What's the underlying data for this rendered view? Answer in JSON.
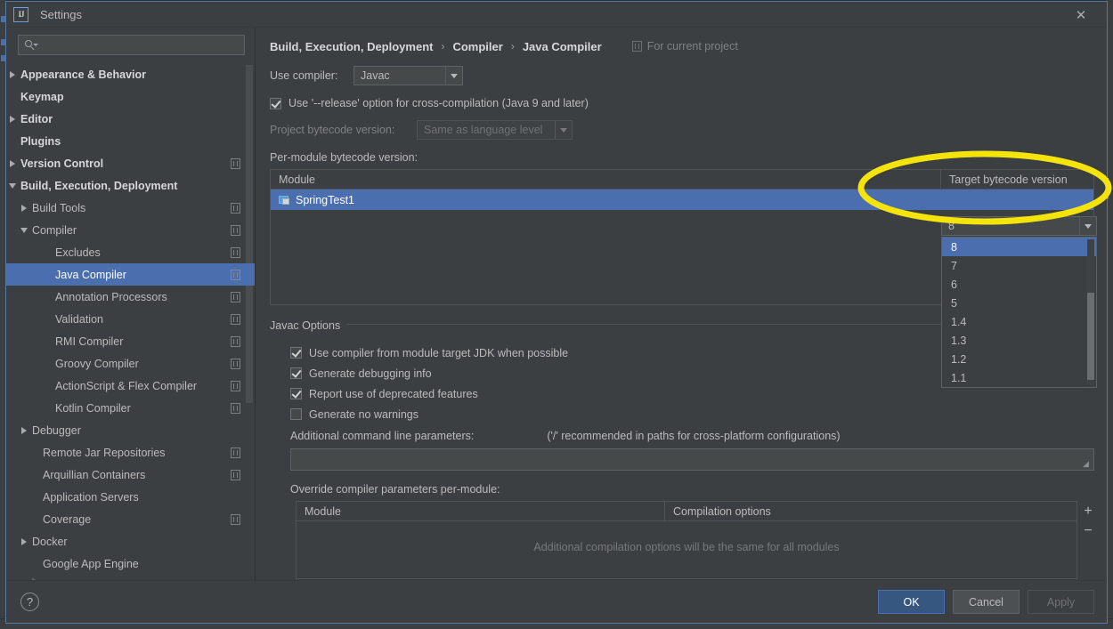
{
  "window": {
    "title": "Settings",
    "logo_text": "IJ",
    "close_label": "✕"
  },
  "sidebar": {
    "search": {
      "value": "",
      "placeholder": ""
    },
    "items": [
      {
        "label": "Appearance & Behavior",
        "twisty": "right",
        "bold": true,
        "indent": 10,
        "badge": false,
        "selected": false
      },
      {
        "label": "Keymap",
        "twisty": "none",
        "bold": true,
        "indent": 10,
        "badge": false,
        "selected": false
      },
      {
        "label": "Editor",
        "twisty": "right",
        "bold": true,
        "indent": 10,
        "badge": false,
        "selected": false
      },
      {
        "label": "Plugins",
        "twisty": "none",
        "bold": true,
        "indent": 10,
        "badge": false,
        "selected": false
      },
      {
        "label": "Version Control",
        "twisty": "right",
        "bold": true,
        "indent": 10,
        "badge": true,
        "selected": false
      },
      {
        "label": "Build, Execution, Deployment",
        "twisty": "down",
        "bold": true,
        "indent": 10,
        "badge": false,
        "selected": false
      },
      {
        "label": "Build Tools",
        "twisty": "right",
        "bold": false,
        "indent": 26,
        "badge": true,
        "selected": false
      },
      {
        "label": "Compiler",
        "twisty": "down",
        "bold": false,
        "indent": 26,
        "badge": true,
        "selected": false
      },
      {
        "label": "Excludes",
        "twisty": "none",
        "bold": false,
        "indent": 52,
        "badge": true,
        "selected": false
      },
      {
        "label": "Java Compiler",
        "twisty": "none",
        "bold": false,
        "indent": 52,
        "badge": true,
        "selected": true
      },
      {
        "label": "Annotation Processors",
        "twisty": "none",
        "bold": false,
        "indent": 52,
        "badge": true,
        "selected": false
      },
      {
        "label": "Validation",
        "twisty": "none",
        "bold": false,
        "indent": 52,
        "badge": true,
        "selected": false
      },
      {
        "label": "RMI Compiler",
        "twisty": "none",
        "bold": false,
        "indent": 52,
        "badge": true,
        "selected": false
      },
      {
        "label": "Groovy Compiler",
        "twisty": "none",
        "bold": false,
        "indent": 52,
        "badge": true,
        "selected": false
      },
      {
        "label": "ActionScript & Flex Compiler",
        "twisty": "none",
        "bold": false,
        "indent": 52,
        "badge": true,
        "selected": false
      },
      {
        "label": "Kotlin Compiler",
        "twisty": "none",
        "bold": false,
        "indent": 52,
        "badge": true,
        "selected": false
      },
      {
        "label": "Debugger",
        "twisty": "right",
        "bold": false,
        "indent": 26,
        "badge": false,
        "selected": false
      },
      {
        "label": "Remote Jar Repositories",
        "twisty": "none",
        "bold": false,
        "indent": 38,
        "badge": true,
        "selected": false
      },
      {
        "label": "Arquillian Containers",
        "twisty": "none",
        "bold": false,
        "indent": 38,
        "badge": true,
        "selected": false
      },
      {
        "label": "Application Servers",
        "twisty": "none",
        "bold": false,
        "indent": 38,
        "badge": false,
        "selected": false
      },
      {
        "label": "Coverage",
        "twisty": "none",
        "bold": false,
        "indent": 38,
        "badge": true,
        "selected": false
      },
      {
        "label": "Docker",
        "twisty": "right",
        "bold": false,
        "indent": 26,
        "badge": false,
        "selected": false
      },
      {
        "label": "Google App Engine",
        "twisty": "none",
        "bold": false,
        "indent": 38,
        "badge": false,
        "selected": false
      }
    ]
  },
  "main": {
    "breadcrumb": {
      "parts": [
        "Build, Execution, Deployment",
        "Compiler",
        "Java Compiler"
      ],
      "separator": "›"
    },
    "for_current_project": "For current project",
    "use_compiler": {
      "label": "Use compiler:",
      "value": "Javac"
    },
    "release_option": {
      "label": "Use '--release' option for cross-compilation (Java 9 and later)",
      "checked": true
    },
    "project_bytecode": {
      "label": "Project bytecode version:",
      "value": "Same as language level",
      "disabled": true
    },
    "per_module": {
      "label": "Per-module bytecode version:",
      "columns": [
        "Module",
        "Target bytecode version"
      ],
      "rows": [
        {
          "module": "SpringTest1",
          "target": "8",
          "selected": true
        }
      ],
      "add_button": "+",
      "remove_button": "−"
    },
    "bytecode_dropdown": {
      "open": true,
      "selected": "8",
      "options": [
        "8",
        "7",
        "6",
        "5",
        "1.4",
        "1.3",
        "1.2",
        "1.1"
      ]
    },
    "javac_options": {
      "title": "Javac Options",
      "checkboxes": [
        {
          "label": "Use compiler from module target JDK when possible",
          "checked": true
        },
        {
          "label": "Generate debugging info",
          "checked": true
        },
        {
          "label": "Report use of deprecated features",
          "checked": true
        },
        {
          "label": "Generate no warnings",
          "checked": false
        }
      ],
      "additional_params_label": "Additional command line parameters:",
      "additional_params_hint": "('/' recommended in paths for cross-platform configurations)",
      "additional_params_value": ""
    },
    "override_params": {
      "label": "Override compiler parameters per-module:",
      "columns": [
        "Module",
        "Compilation options"
      ],
      "empty_text": "Additional compilation options will be the same for all modules",
      "add_button": "+",
      "remove_button": "−"
    }
  },
  "footer": {
    "help": "?",
    "ok": "OK",
    "cancel": "Cancel",
    "apply": "Apply"
  },
  "annotation": {
    "shape": "ellipse",
    "color": "#f5e40c",
    "stroke_width": 7
  },
  "colors": {
    "dialog_bg": "#3c3f41",
    "selection_blue": "#4b6eaf",
    "primary_button": "#365880",
    "text": "#bbbbbb",
    "annotation_yellow": "#f5e40c"
  }
}
